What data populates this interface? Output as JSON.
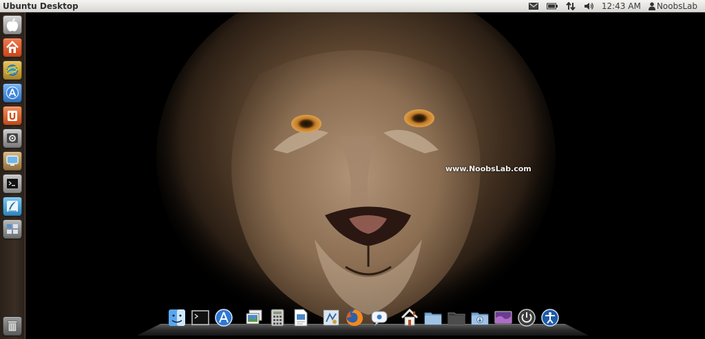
{
  "topbar": {
    "title": "Ubuntu Desktop",
    "indicators": {
      "mail": "mail-icon",
      "battery": "battery-icon",
      "network": "network-arrows-icon",
      "sound": "speaker-icon",
      "clock": "12:43 AM",
      "user_icon": "person-icon",
      "user": "NoobsLab"
    }
  },
  "launcher": {
    "items": [
      {
        "name": "apple-logo",
        "icon": "apple-icon"
      },
      {
        "name": "home-folder",
        "icon": "home-icon"
      },
      {
        "name": "browser",
        "icon": "globe-icon"
      },
      {
        "name": "app-store",
        "icon": "app-store-icon"
      },
      {
        "name": "software-center",
        "icon": "u-bag-icon"
      },
      {
        "name": "system-settings",
        "icon": "settings-icon"
      },
      {
        "name": "display",
        "icon": "monitor-icon"
      },
      {
        "name": "terminal",
        "icon": "terminal-icon"
      },
      {
        "name": "text-editor",
        "icon": "quill-icon"
      },
      {
        "name": "workspace-switcher",
        "icon": "workspaces-icon"
      },
      {
        "name": "trash",
        "icon": "trash-icon"
      }
    ]
  },
  "desktop": {
    "watermark": "www.NoobsLab.com",
    "wallpaper": "lion-face"
  },
  "dock": {
    "items": [
      "finder-icon",
      "terminal-icon",
      "app-store-icon",
      "photos-icon",
      "calculator-icon",
      "text-document-icon",
      "mail-stamp-icon",
      "firefox-icon",
      "chat-icon",
      "home-icon",
      "folder-icon",
      "dark-folder-icon",
      "downloads-folder-icon",
      "screen-icon",
      "power-icon",
      "accessibility-icon"
    ]
  },
  "colors": {
    "panel": "#e2e1dd",
    "launcher": "#33281f",
    "accent": "#dd4814"
  }
}
